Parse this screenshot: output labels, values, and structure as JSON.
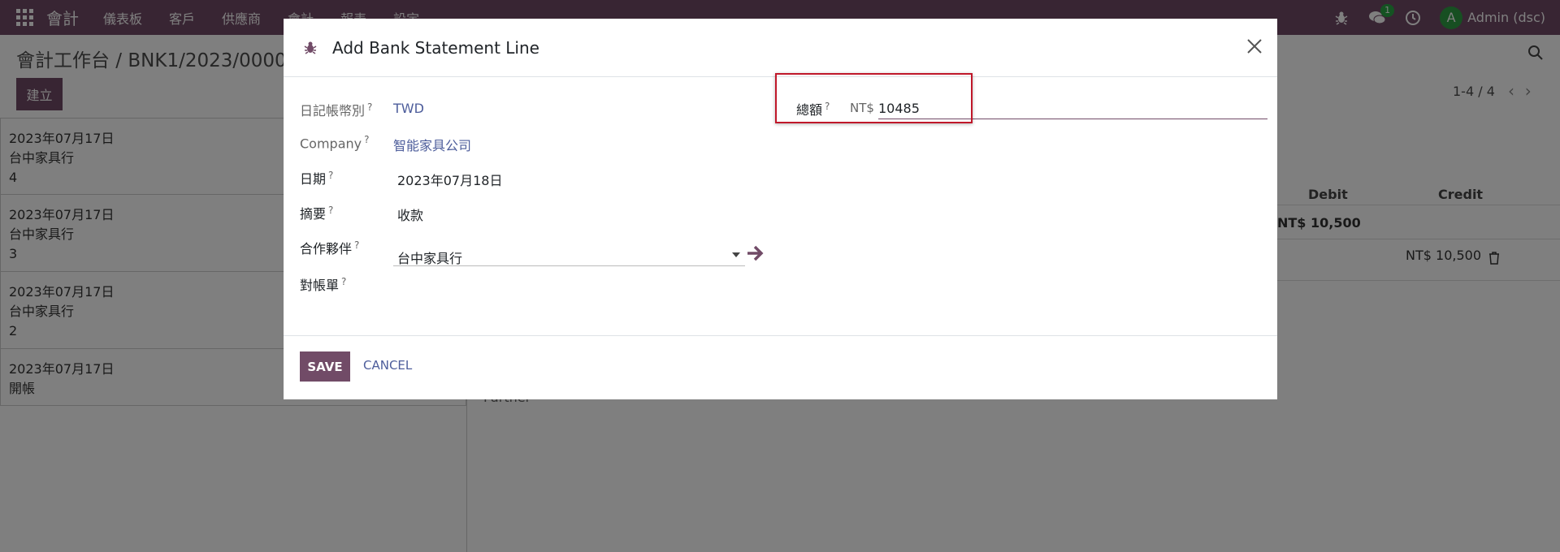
{
  "navbar": {
    "brand": "會計",
    "menu": [
      "儀表板",
      "客戶",
      "供應商",
      "會計",
      "報表",
      "設定"
    ],
    "chat_count": "1",
    "avatar_letter": "A",
    "user": "Admin (dsc)",
    "icons": [
      "apps-icon",
      "bug-icon",
      "chat-icon",
      "clock-icon"
    ]
  },
  "control_panel": {
    "breadcrumb": "會計工作台 / BNK1/2023/00004",
    "create_label": "建立",
    "pager": "1-4 / 4"
  },
  "statements": [
    {
      "date": "2023年07月17日",
      "partner": "台中家具行",
      "ref": "4"
    },
    {
      "date": "2023年07月17日",
      "partner": "台中家具行",
      "ref": "3"
    },
    {
      "date": "2023年07月17日",
      "partner": "台中家具行",
      "ref": "2"
    },
    {
      "date": "2023年07月17日",
      "partner": "開帳",
      "ref": ""
    }
  ],
  "background": {
    "col_debit": "Debit",
    "col_credit": "Credit",
    "subtotal": "NT$ 10,500",
    "line_credit": "NT$ 10,500",
    "partner_label": "Partner"
  },
  "modal": {
    "title": "Add Bank Statement Line",
    "fields": {
      "journal_currency": {
        "label": "日記帳幣別",
        "value": "TWD"
      },
      "company": {
        "label": "Company",
        "value": "智能家具公司"
      },
      "date": {
        "label": "日期",
        "value": "2023年07月18日"
      },
      "memo": {
        "label": "摘要",
        "value": "收款"
      },
      "partner": {
        "label": "合作夥伴",
        "value": "台中家具行"
      },
      "reconcile": {
        "label": "對帳單",
        "value": ""
      },
      "amount": {
        "label": "總額",
        "currency": "NT$",
        "value": "10485"
      }
    },
    "help_mark": "?",
    "save_label": "SAVE",
    "cancel_label": "CANCEL"
  },
  "colors": {
    "brand": "#714b67",
    "link": "#4d5d9b",
    "highlight": "#c0182a"
  }
}
